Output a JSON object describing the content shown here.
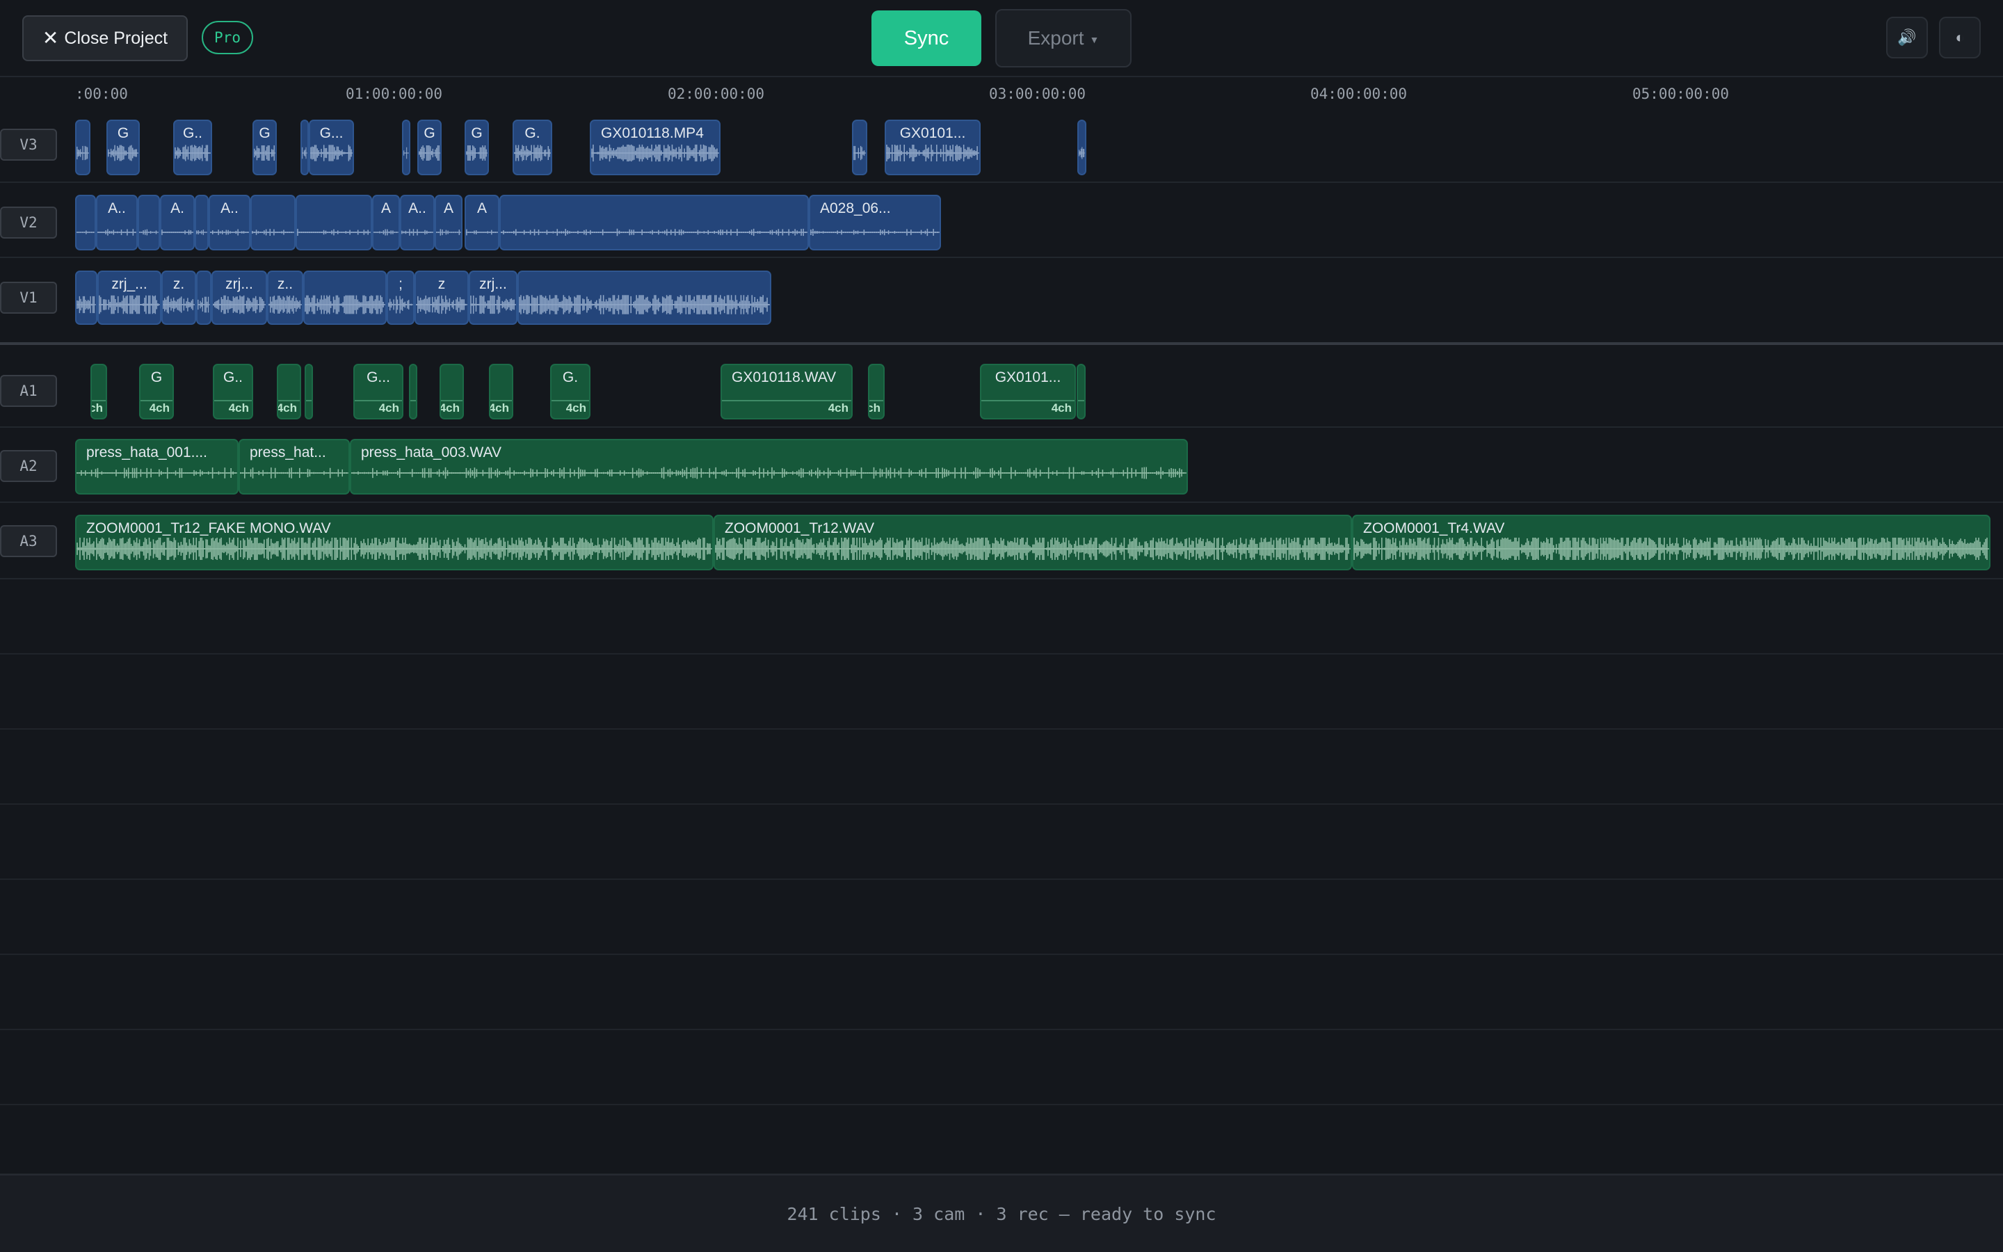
{
  "header": {
    "close_label": "Close Project",
    "close_icon": "close-icon",
    "pro_badge": "Pro",
    "sync_label": "Sync",
    "export_label": "Export",
    "volume_icon": "speaker-icon",
    "theme_icon": "half-circle-icon"
  },
  "ruler": {
    "ticks": [
      ":00:00",
      "01:00:00:00",
      "02:00:00:00",
      "03:00:00:00",
      "04:00:00:00",
      "05:00:00:00"
    ]
  },
  "tracks": {
    "video": [
      {
        "name": "V3",
        "clips": [
          {
            "label": ""
          },
          {
            "label": "G"
          },
          {
            "label": "G.."
          },
          {
            "label": "G"
          },
          {
            "label": ""
          },
          {
            "label": "G..."
          },
          {
            "label": ""
          },
          {
            "label": "G"
          },
          {
            "label": "G"
          },
          {
            "label": "G."
          },
          {
            "label": "GX010118.MP4"
          },
          {
            "label": ""
          },
          {
            "label": "GX0101..."
          },
          {
            "label": ""
          }
        ]
      },
      {
        "name": "V2",
        "clips": [
          {
            "label": ""
          },
          {
            "label": "A.."
          },
          {
            "label": ""
          },
          {
            "label": "A."
          },
          {
            "label": ""
          },
          {
            "label": "A.."
          },
          {
            "label": ""
          },
          {
            "label": ""
          },
          {
            "label": "A"
          },
          {
            "label": "A.."
          },
          {
            "label": "A"
          },
          {
            "label": "A"
          },
          {
            "label": ""
          },
          {
            "label": "A028_06..."
          }
        ]
      },
      {
        "name": "V1",
        "clips": [
          {
            "label": ""
          },
          {
            "label": "zrj_..."
          },
          {
            "label": "z."
          },
          {
            "label": ""
          },
          {
            "label": "zrj..."
          },
          {
            "label": "z.."
          },
          {
            "label": ""
          },
          {
            "label": ";"
          },
          {
            "label": "z"
          },
          {
            "label": "zrj..."
          },
          {
            "label": ""
          }
        ]
      }
    ],
    "audio": [
      {
        "name": "A1",
        "clips": [
          {
            "label": "",
            "ch": "ch"
          },
          {
            "label": "G",
            "ch": "4ch"
          },
          {
            "label": "G..",
            "ch": "4ch"
          },
          {
            "label": "",
            "ch": "4ch"
          },
          {
            "label": "",
            "ch": ""
          },
          {
            "label": "G...",
            "ch": "4ch"
          },
          {
            "label": "",
            "ch": ""
          },
          {
            "label": "",
            "ch": "4ch"
          },
          {
            "label": "",
            "ch": "4ch"
          },
          {
            "label": "G.",
            "ch": "4ch"
          },
          {
            "label": "GX010118.WAV",
            "ch": "4ch"
          },
          {
            "label": "",
            "ch": "ch"
          },
          {
            "label": "GX0101...",
            "ch": "4ch"
          },
          {
            "label": "",
            "ch": ""
          }
        ]
      },
      {
        "name": "A2",
        "clips": [
          {
            "label": "press_hata_001...."
          },
          {
            "label": "press_hat..."
          },
          {
            "label": "press_hata_003.WAV"
          }
        ]
      },
      {
        "name": "A3",
        "clips": [
          {
            "label": "ZOOM0001_Tr12_FAKE MONO.WAV"
          },
          {
            "label": "ZOOM0001_Tr12.WAV"
          },
          {
            "label": "ZOOM0001_Tr4.WAV"
          }
        ]
      }
    ]
  },
  "status": "241 clips · 3 cam · 3 rec — ready to sync",
  "colors": {
    "background": "#14171c",
    "video_clip": "#24457a",
    "audio_clip": "#16583a",
    "accent": "#22c08c"
  }
}
